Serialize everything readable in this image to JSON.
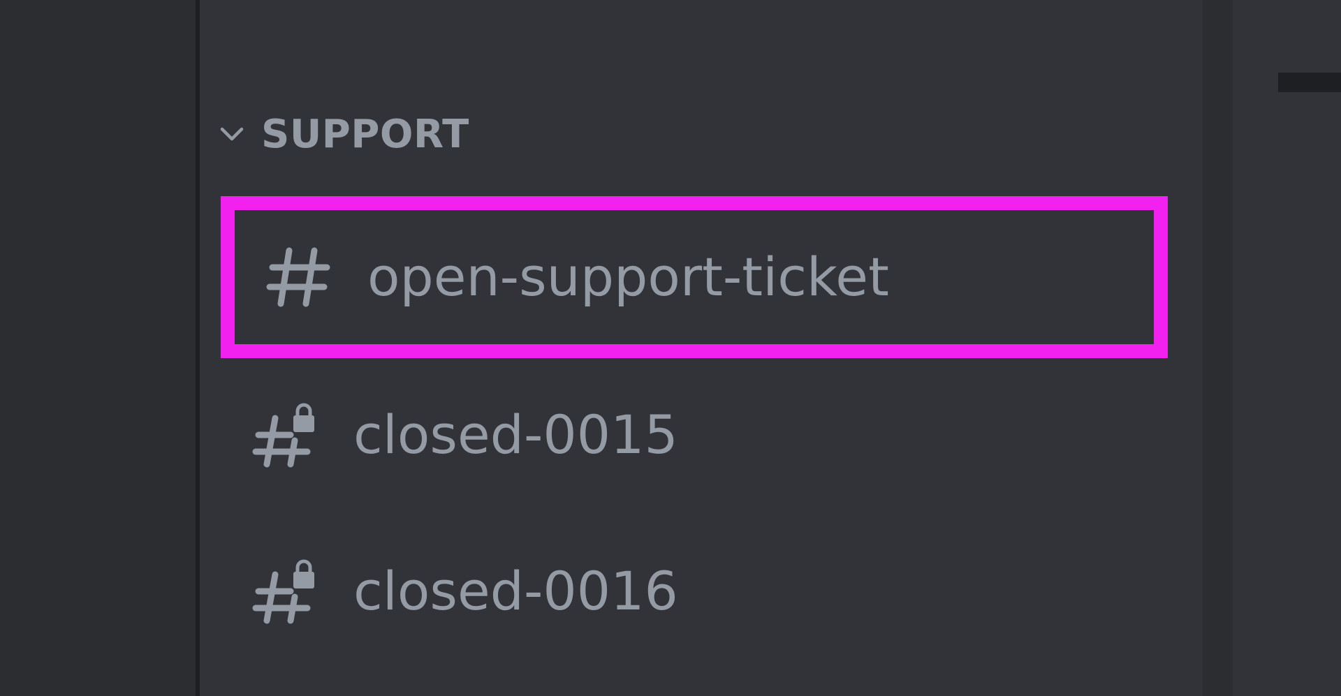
{
  "sidebar": {
    "category": {
      "label": "SUPPORT",
      "icon": "chevron-down-icon",
      "collapsed": false
    },
    "channels": [
      {
        "name": "open-support-ticket",
        "icon": "hash-icon",
        "locked": false,
        "highlighted": true
      },
      {
        "name": "closed-0015",
        "icon": "locked-hash-icon",
        "locked": true,
        "highlighted": false
      },
      {
        "name": "closed-0016",
        "icon": "locked-hash-icon",
        "locked": true,
        "highlighted": false
      }
    ]
  },
  "colors": {
    "background": "#313338",
    "sidebar_dark": "#2b2d31",
    "text_muted": "#949ba4",
    "highlight_border": "#f321f0"
  }
}
